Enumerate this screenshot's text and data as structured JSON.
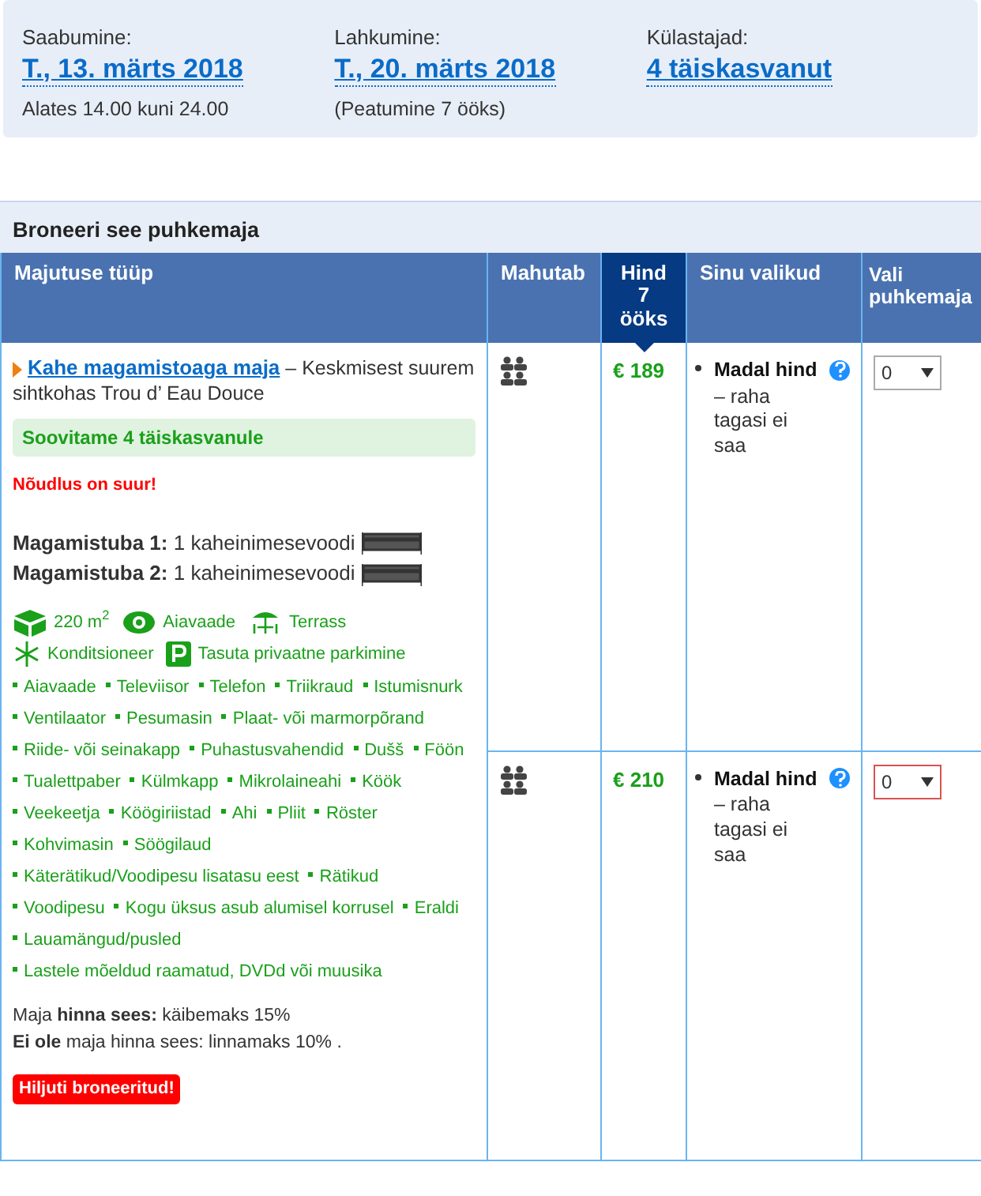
{
  "stay": [
    {
      "label": "Saabumine:",
      "value": "T., 13. märts 2018",
      "note": "Alates 14.00 kuni 24.00"
    },
    {
      "label": "Lahkumine:",
      "value": "T., 20. märts 2018",
      "note": "(Peatumine 7 ööks)"
    },
    {
      "label": "Külastajad:",
      "value": "4 täiskasvanut"
    }
  ],
  "section_title": "Broneeri see puhkemaja",
  "table": {
    "columns": [
      {
        "label": "Majutuse tüüp",
        "highlighted": false
      },
      {
        "label": "Mahutab",
        "highlighted": false
      },
      {
        "label": "Hind 7 ööks",
        "highlighted": true
      },
      {
        "label": "Sinu valikud",
        "highlighted": false
      },
      {
        "label": "Vali puhkemaja",
        "highlighted": false
      }
    ],
    "property": {
      "name": "Kahe magamistoaga maja",
      "description": "– Keskmisest suurem sihtkohas Trou d’ Eau Douce",
      "recommendation": "Soovitame 4 täiskasvanule",
      "demand": "Nõudlus on suur!",
      "bedrooms": [
        "**Magamistuba 1:** 1 kaheinimesevoodi",
        "**Magamistuba 2:** 1 kaheinimesevoodi"
      ],
      "facilities": [
        [
          {
            "kind": "area",
            "text": "220 m$^{2}$"
          },
          {
            "kind": "view",
            "text": "Aiavaade"
          },
          {
            "kind": "terrace",
            "text": "Terrass"
          }
        ],
        [
          {
            "kind": "ac",
            "text": "Konditsioneer"
          },
          {
            "kind": "parking",
            "text": "Tasuta privaatne parkimine"
          }
        ]
      ],
      "amenities": [
        [
          "Aiavaade",
          "Televiisor",
          "Telefon",
          "Triikraud",
          "Istumisnurk"
        ],
        [
          "Ventilaator",
          "Pesumasin",
          "Plaat- või marmorpõrand"
        ],
        [
          "Riide- või seinakapp",
          "Puhastusvahendid",
          "Dušš",
          "Föön"
        ],
        [
          "Tualettpaber",
          "Külmkapp",
          "Mikrolaineahi",
          "Köök"
        ],
        [
          "Veekeetja",
          "Köögiriistad",
          "Ahi",
          "Pliit",
          "Röster"
        ],
        [
          "Kohvimasin",
          "Söögilaud"
        ],
        [
          "Käterätikud/Voodipesu lisatasu eest",
          "Rätikud"
        ],
        [
          "Voodipesu",
          "Kogu üksus asub alumisel korrusel",
          "Eraldi"
        ],
        [
          "Lauamängud/pusled"
        ],
        [
          "Lastele mõeldud raamatud, DVDd või muusika"
        ]
      ],
      "tax_notes": [
        "Maja **hinna sees:** käibemaks 15%",
        "**Ei ole** maja hinna sees: linnamaks 10% ."
      ],
      "badge": "Hiljuti broneeritud!"
    },
    "rows": [
      {
        "price": "€ 189",
        "option_title": "Madal hind",
        "option_note": "– raha tagasi ei saa",
        "quantity": "0",
        "focused": false
      },
      {
        "price": "€ 210",
        "option_title": "Madal hind",
        "option_note": "– raha tagasi ei saa",
        "quantity": "0",
        "focused": true
      }
    ]
  }
}
